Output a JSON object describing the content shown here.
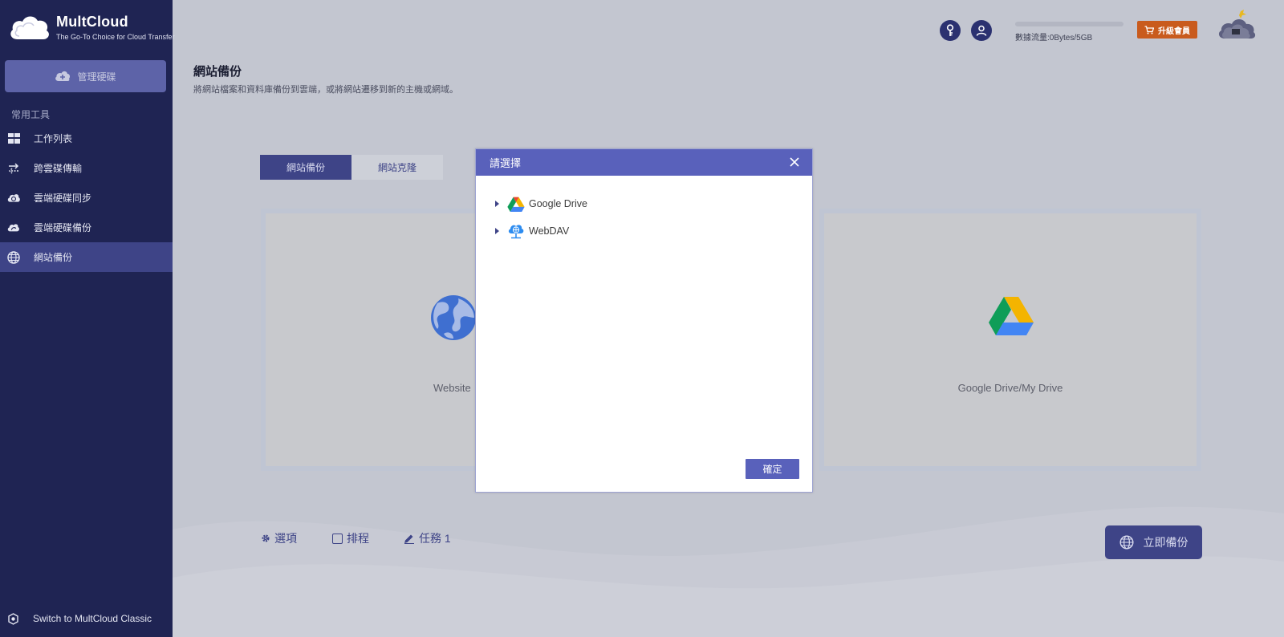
{
  "brand": {
    "name": "MultCloud",
    "tagline": "The Go-To Choice for Cloud Transfer"
  },
  "sidebar": {
    "manage_label": "管理硬碟",
    "section_label": "常用工具",
    "items": [
      {
        "label": "工作列表",
        "icon": "grid-icon"
      },
      {
        "label": "跨雲碟傳輸",
        "icon": "transfer-arrows-icon"
      },
      {
        "label": "雲端硬碟同步",
        "icon": "cloud-sync-icon"
      },
      {
        "label": "雲端硬碟備份",
        "icon": "cloud-backup-icon"
      },
      {
        "label": "網站備份",
        "icon": "globe-icon",
        "active": true
      }
    ],
    "switch_label": "Switch to MultCloud Classic"
  },
  "header": {
    "traffic_text": "數據流量:0Bytes/5GB",
    "traffic_used_fraction": 0,
    "upgrade_label": "升級會員"
  },
  "page": {
    "title": "網站備份",
    "description": "將網站檔案和資料庫備份到雲端，或將網站遷移到新的主機或網域。",
    "tabs": [
      {
        "label": "網站備份",
        "active": true
      },
      {
        "label": "網站克隆",
        "active": false
      }
    ],
    "source_label": "Website",
    "target_label": "Google Drive/My Drive"
  },
  "bottom": {
    "options_label": "選項",
    "schedule_label": "排程",
    "task_label": "任務 1",
    "backup_now_label": "立即備份"
  },
  "dialog": {
    "title": "請選擇",
    "items": [
      {
        "label": "Google Drive",
        "icon": "google-drive-icon"
      },
      {
        "label": "WebDAV",
        "icon": "webdav-icon"
      }
    ],
    "ok_label": "確定"
  },
  "colors": {
    "sidebar_bg": "#1f2453",
    "accent": "#3e4487",
    "dialog_accent": "#5961bb",
    "upgrade": "#c95b1d"
  }
}
